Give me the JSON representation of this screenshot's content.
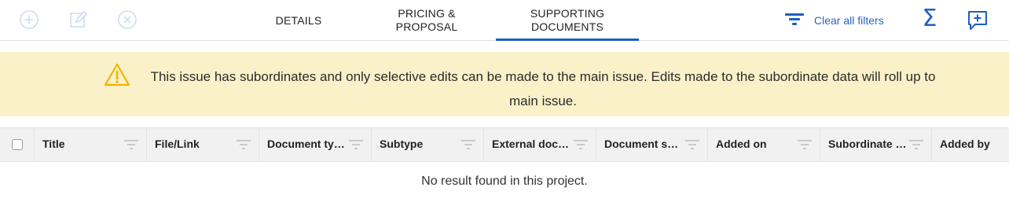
{
  "toolbar": {
    "actions": [
      {
        "name": "add",
        "icon": "add-circle-icon",
        "disabled": true
      },
      {
        "name": "edit",
        "icon": "edit-icon",
        "disabled": true
      },
      {
        "name": "remove",
        "icon": "close-circle-icon",
        "disabled": true
      }
    ],
    "tabs": [
      {
        "label": "DETAILS",
        "active": false
      },
      {
        "label": "PRICING & PROPOSAL",
        "active": false
      },
      {
        "label": "SUPPORTING DOCUMENTS",
        "active": true
      }
    ],
    "clear_filters_label": "Clear all filters",
    "sigma_label": "Σ",
    "accent_color": "#1f5fbf"
  },
  "banner": {
    "icon": "warning-icon",
    "message": "This issue has subordinates and only selective edits can be made to the main issue. Edits made to the subordinate data will roll up to main issue.",
    "background": "#fbf1c9"
  },
  "table": {
    "columns": [
      {
        "label": "Title"
      },
      {
        "label": "File/Link"
      },
      {
        "label": "Document ty…"
      },
      {
        "label": "Subtype"
      },
      {
        "label": "External doc…"
      },
      {
        "label": "Document s…"
      },
      {
        "label": "Added on"
      },
      {
        "label": "Subordinate …"
      },
      {
        "label": "Added by"
      }
    ],
    "empty_message": "No result found in this project."
  }
}
